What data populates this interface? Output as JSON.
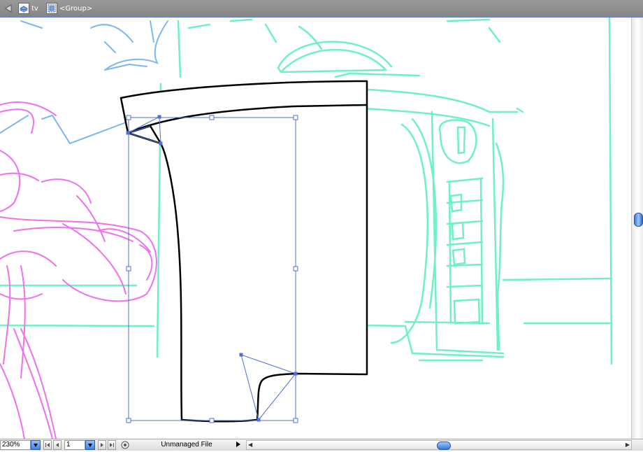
{
  "breadcrumb": {
    "layer_name": "tv",
    "group_name": "<Group>"
  },
  "status_bar": {
    "zoom": "230%",
    "page": "1",
    "status_text": "Unmanaged File"
  },
  "icons": {
    "back": "back-arrow-icon",
    "layer": "layer-icon",
    "group": "group-icon",
    "first_page": "first-page-icon",
    "prev_page": "prev-page-icon",
    "next_page": "next-page-icon",
    "last_page": "last-page-icon",
    "status_menu": "status-menu-icon"
  },
  "colors": {
    "selection": "#4f6fd6",
    "sketch_cyan": "#6ef0c8",
    "sketch_magenta": "#ee70ee",
    "sketch_blue": "#7ab8f0",
    "accent_blue": "#3d86e8"
  }
}
